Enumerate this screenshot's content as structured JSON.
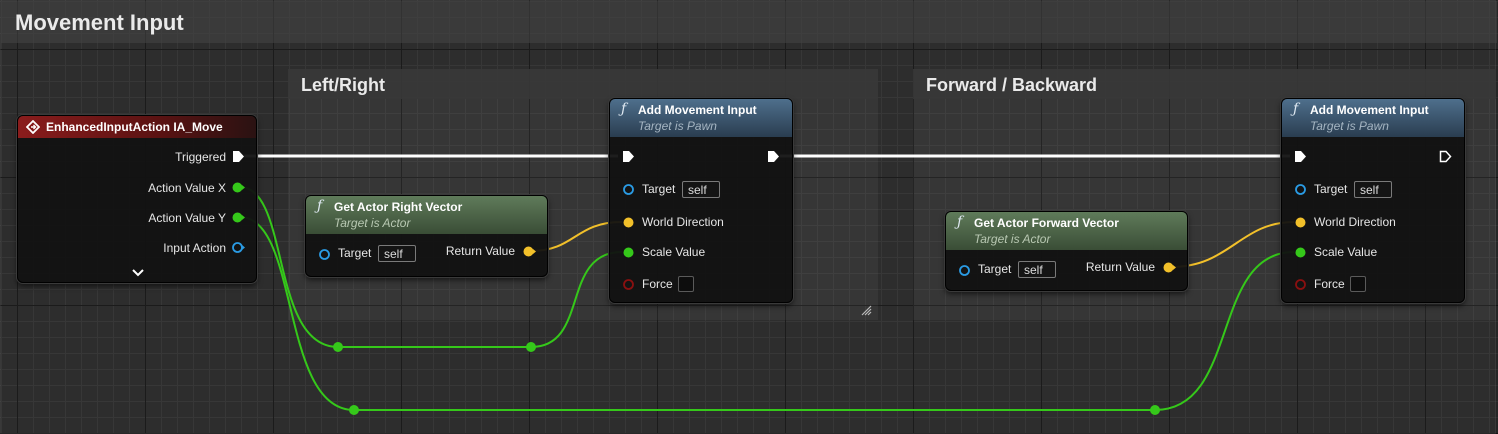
{
  "graph": {
    "title": "Movement Input",
    "colors": {
      "exec": "#ffffff",
      "float": "#35c81a",
      "vector": "#f2c02a",
      "object": "#2a9be4",
      "bool": "#8a1010",
      "event_header": "#8a1c1c",
      "function_header": "#4e6f8c",
      "pure_header": "#5f7b5a"
    }
  },
  "comments": {
    "left_right": {
      "title": "Left/Right"
    },
    "forward_backward": {
      "title": "Forward / Backward"
    }
  },
  "event_node": {
    "title": "EnhancedInputAction IA_Move",
    "icon": "event-diamond-icon",
    "pins": {
      "triggered": "Triggered",
      "action_value_x": "Action Value X",
      "action_value_y": "Action Value Y",
      "input_action": "Input Action"
    },
    "expand_icon": "chevron-down-icon"
  },
  "right_vector_node": {
    "icon": "function-icon",
    "title": "Get Actor Right Vector",
    "subtitle": "Target is Actor",
    "target_label": "Target",
    "target_value": "self",
    "return_label": "Return Value"
  },
  "forward_vector_node": {
    "icon": "function-icon",
    "title": "Get Actor Forward Vector",
    "subtitle": "Target is Actor",
    "target_label": "Target",
    "target_value": "self",
    "return_label": "Return Value"
  },
  "add_move_1": {
    "icon": "function-icon",
    "title": "Add Movement Input",
    "subtitle": "Target is Pawn",
    "target_label": "Target",
    "target_value": "self",
    "world_direction_label": "World Direction",
    "scale_value_label": "Scale Value",
    "force_label": "Force"
  },
  "add_move_2": {
    "icon": "function-icon",
    "title": "Add Movement Input",
    "subtitle": "Target is Pawn",
    "target_label": "Target",
    "target_value": "self",
    "world_direction_label": "World Direction",
    "scale_value_label": "Scale Value",
    "force_label": "Force"
  }
}
